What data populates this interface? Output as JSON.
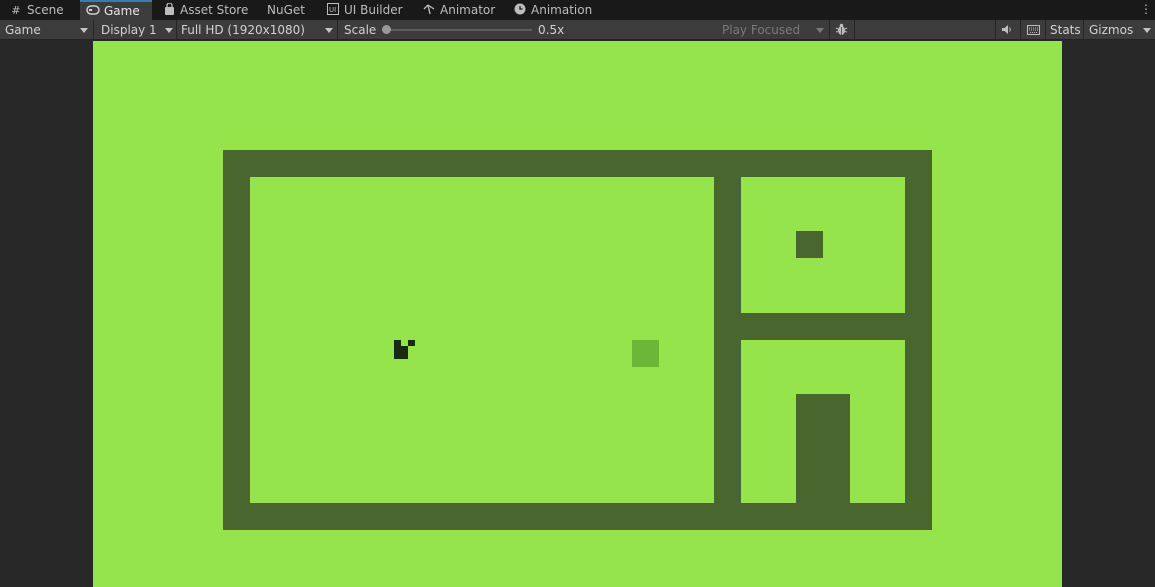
{
  "tabs": [
    {
      "label": "Scene",
      "icon": "grid-icon"
    },
    {
      "label": "Game",
      "icon": "gamepad-icon",
      "active": true
    },
    {
      "label": "Asset Store",
      "icon": "shopping-bag-icon"
    },
    {
      "label": "NuGet",
      "icon": ""
    },
    {
      "label": "UI Builder",
      "icon": "ui-builder-icon"
    },
    {
      "label": "Animator",
      "icon": "animator-icon"
    },
    {
      "label": "Animation",
      "icon": "clock-icon"
    }
  ],
  "toolbar": {
    "view_mode": "Game",
    "display": "Display 1",
    "resolution": "Full HD (1920x1080)",
    "scale_label": "Scale",
    "scale_value": "0.5x",
    "play_mode": "Play Focused",
    "stats": "Stats",
    "gizmos": "Gizmos"
  },
  "colors": {
    "background": "#96e44c",
    "wall": "#4a662f",
    "coin": "#6bb838",
    "player": "#1b2b11",
    "active_tab_accent": "#3a79bb"
  }
}
